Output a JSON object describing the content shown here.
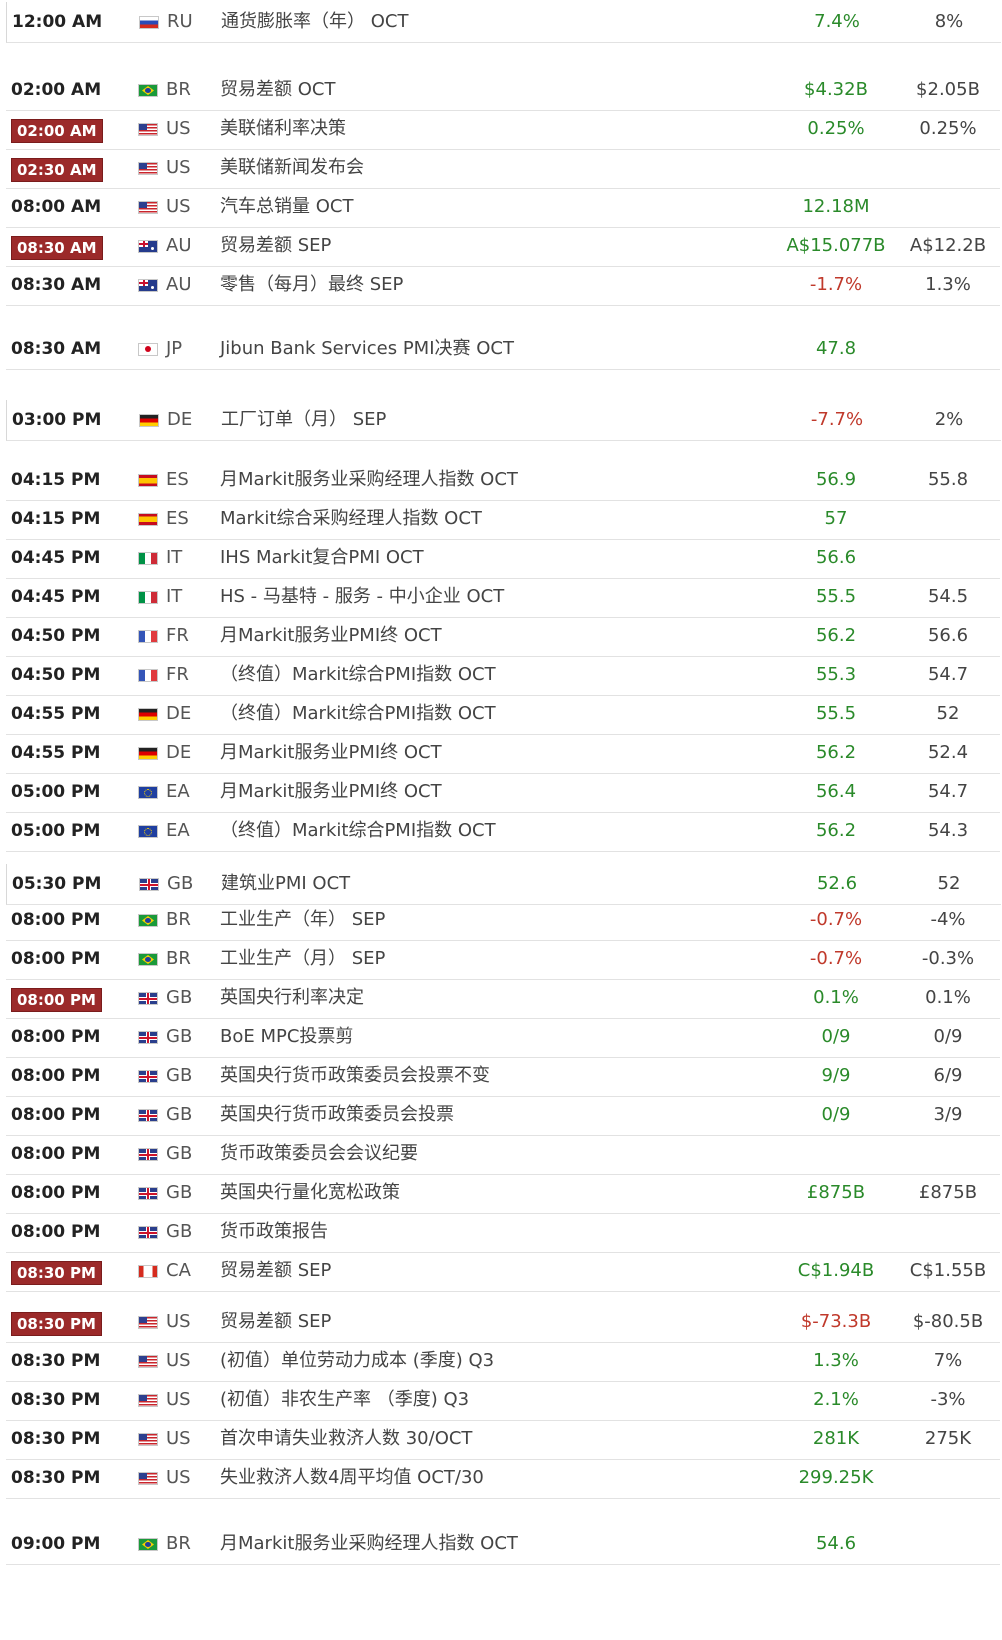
{
  "rows": [
    {
      "time": "12:00 AM",
      "highlight": false,
      "country": "RU",
      "flag": "ru-flag-icon",
      "event": "通货膨胀率（年） OCT",
      "actual": "7.4%",
      "actual_neg": false,
      "previous": "8%"
    },
    {
      "time": "02:00 AM",
      "highlight": false,
      "country": "BR",
      "flag": "br-flag-icon",
      "event": "贸易差额 OCT",
      "actual": "$4.32B",
      "actual_neg": false,
      "previous": "$2.05B"
    },
    {
      "time": "02:00 AM",
      "highlight": true,
      "country": "US",
      "flag": "us-flag-icon",
      "event": "美联储利率决策",
      "actual": "0.25%",
      "actual_neg": false,
      "previous": "0.25%"
    },
    {
      "time": "02:30 AM",
      "highlight": true,
      "country": "US",
      "flag": "us-flag-icon",
      "event": "美联储新闻发布会",
      "actual": "",
      "actual_neg": false,
      "previous": ""
    },
    {
      "time": "08:00 AM",
      "highlight": false,
      "country": "US",
      "flag": "us-flag-icon",
      "event": "汽车总销量 OCT",
      "actual": "12.18M",
      "actual_neg": false,
      "previous": ""
    },
    {
      "time": "08:30 AM",
      "highlight": true,
      "country": "AU",
      "flag": "au-flag-icon",
      "event": "贸易差额 SEP",
      "actual": "A$15.077B",
      "actual_neg": false,
      "previous": "A$12.2B"
    },
    {
      "time": "08:30 AM",
      "highlight": false,
      "country": "AU",
      "flag": "au-flag-icon",
      "event": "零售（每月）最终 SEP",
      "actual": "-1.7%",
      "actual_neg": true,
      "previous": "1.3%"
    },
    {
      "time": "08:30 AM",
      "highlight": false,
      "country": "JP",
      "flag": "jp-flag-icon",
      "event": "Jibun Bank Services PMI决赛 OCT",
      "actual": "47.8",
      "actual_neg": false,
      "previous": ""
    },
    {
      "time": "03:00 PM",
      "highlight": false,
      "country": "DE",
      "flag": "de-flag-icon",
      "event": "工厂订单（月） SEP",
      "actual": "-7.7%",
      "actual_neg": true,
      "previous": "2%"
    },
    {
      "time": "04:15 PM",
      "highlight": false,
      "country": "ES",
      "flag": "es-flag-icon",
      "event": "月Markit服务业采购经理人指数 OCT",
      "actual": "56.9",
      "actual_neg": false,
      "previous": "55.8"
    },
    {
      "time": "04:15 PM",
      "highlight": false,
      "country": "ES",
      "flag": "es-flag-icon",
      "event": "Markit综合采购经理人指数 OCT",
      "actual": "57",
      "actual_neg": false,
      "previous": ""
    },
    {
      "time": "04:45 PM",
      "highlight": false,
      "country": "IT",
      "flag": "it-flag-icon",
      "event": "IHS Markit复合PMI OCT",
      "actual": "56.6",
      "actual_neg": false,
      "previous": ""
    },
    {
      "time": "04:45 PM",
      "highlight": false,
      "country": "IT",
      "flag": "it-flag-icon",
      "event": "HS - 马基特 - 服务 - 中小企业 OCT",
      "actual": "55.5",
      "actual_neg": false,
      "previous": "54.5"
    },
    {
      "time": "04:50 PM",
      "highlight": false,
      "country": "FR",
      "flag": "fr-flag-icon",
      "event": "月Markit服务业PMI终 OCT",
      "actual": "56.2",
      "actual_neg": false,
      "previous": "56.6"
    },
    {
      "time": "04:50 PM",
      "highlight": false,
      "country": "FR",
      "flag": "fr-flag-icon",
      "event": "（终值）Markit综合PMI指数 OCT",
      "actual": "55.3",
      "actual_neg": false,
      "previous": "54.7"
    },
    {
      "time": "04:55 PM",
      "highlight": false,
      "country": "DE",
      "flag": "de-flag-icon",
      "event": "（终值）Markit综合PMI指数 OCT",
      "actual": "55.5",
      "actual_neg": false,
      "previous": "52"
    },
    {
      "time": "04:55 PM",
      "highlight": false,
      "country": "DE",
      "flag": "de-flag-icon",
      "event": "月Markit服务业PMI终 OCT",
      "actual": "56.2",
      "actual_neg": false,
      "previous": "52.4"
    },
    {
      "time": "05:00 PM",
      "highlight": false,
      "country": "EA",
      "flag": "ea-flag-icon",
      "event": "月Markit服务业PMI终 OCT",
      "actual": "56.4",
      "actual_neg": false,
      "previous": "54.7"
    },
    {
      "time": "05:00 PM",
      "highlight": false,
      "country": "EA",
      "flag": "ea-flag-icon",
      "event": "（终值）Markit综合PMI指数 OCT",
      "actual": "56.2",
      "actual_neg": false,
      "previous": "54.3"
    },
    {
      "time": "05:30 PM",
      "highlight": false,
      "country": "GB",
      "flag": "gb-flag-icon",
      "event": "建筑业PMI OCT",
      "actual": "52.6",
      "actual_neg": false,
      "previous": "52"
    },
    {
      "time": "08:00 PM",
      "highlight": false,
      "country": "BR",
      "flag": "br-flag-icon",
      "event": "工业生产（年） SEP",
      "actual": "-0.7%",
      "actual_neg": true,
      "previous": "-4%"
    },
    {
      "time": "08:00 PM",
      "highlight": false,
      "country": "BR",
      "flag": "br-flag-icon",
      "event": "工业生产（月） SEP",
      "actual": "-0.7%",
      "actual_neg": true,
      "previous": "-0.3%"
    },
    {
      "time": "08:00 PM",
      "highlight": true,
      "country": "GB",
      "flag": "gb-flag-icon",
      "event": "英国央行利率决定",
      "actual": "0.1%",
      "actual_neg": false,
      "previous": "0.1%"
    },
    {
      "time": "08:00 PM",
      "highlight": false,
      "country": "GB",
      "flag": "gb-flag-icon",
      "event": "BoE MPC投票剪",
      "actual": "0/9",
      "actual_neg": false,
      "previous": "0/9"
    },
    {
      "time": "08:00 PM",
      "highlight": false,
      "country": "GB",
      "flag": "gb-flag-icon",
      "event": "英国央行货币政策委员会投票不变",
      "actual": "9/9",
      "actual_neg": false,
      "previous": "6/9"
    },
    {
      "time": "08:00 PM",
      "highlight": false,
      "country": "GB",
      "flag": "gb-flag-icon",
      "event": "英国央行货币政策委员会投票",
      "actual": "0/9",
      "actual_neg": false,
      "previous": "3/9"
    },
    {
      "time": "08:00 PM",
      "highlight": false,
      "country": "GB",
      "flag": "gb-flag-icon",
      "event": "货币政策委员会会议纪要",
      "actual": "",
      "actual_neg": false,
      "previous": ""
    },
    {
      "time": "08:00 PM",
      "highlight": false,
      "country": "GB",
      "flag": "gb-flag-icon",
      "event": "英国央行量化宽松政策",
      "actual": "£875B",
      "actual_neg": false,
      "previous": "£875B"
    },
    {
      "time": "08:00 PM",
      "highlight": false,
      "country": "GB",
      "flag": "gb-flag-icon",
      "event": "货币政策报告",
      "actual": "",
      "actual_neg": false,
      "previous": ""
    },
    {
      "time": "08:30 PM",
      "highlight": true,
      "country": "CA",
      "flag": "ca-flag-icon",
      "event": "贸易差额 SEP",
      "actual": "C$1.94B",
      "actual_neg": false,
      "previous": "C$1.55B"
    },
    {
      "time": "08:30 PM",
      "highlight": true,
      "country": "US",
      "flag": "us-flag-icon",
      "event": "贸易差额 SEP",
      "actual": "$-73.3B",
      "actual_neg": true,
      "previous": "$-80.5B"
    },
    {
      "time": "08:30 PM",
      "highlight": false,
      "country": "US",
      "flag": "us-flag-icon",
      "event": "(初值）单位劳动力成本 (季度) Q3",
      "actual": "1.3%",
      "actual_neg": false,
      "previous": "7%"
    },
    {
      "time": "08:30 PM",
      "highlight": false,
      "country": "US",
      "flag": "us-flag-icon",
      "event": "(初值）非农生产率 （季度) Q3",
      "actual": "2.1%",
      "actual_neg": false,
      "previous": "-3%"
    },
    {
      "time": "08:30 PM",
      "highlight": false,
      "country": "US",
      "flag": "us-flag-icon",
      "event": "首次申请失业救济人数 30/OCT",
      "actual": "281K",
      "actual_neg": false,
      "previous": "275K"
    },
    {
      "time": "08:30 PM",
      "highlight": false,
      "country": "US",
      "flag": "us-flag-icon",
      "event": "失业救济人数4周平均值 OCT/30",
      "actual": "299.25K",
      "actual_neg": false,
      "previous": ""
    },
    {
      "time": "09:00 PM",
      "highlight": false,
      "country": "BR",
      "flag": "br-flag-icon",
      "event": "月Markit服务业采购经理人指数 OCT",
      "actual": "54.6",
      "actual_neg": false,
      "previous": ""
    }
  ],
  "colors": {
    "highlight_bg": "#9b2a2a",
    "positive": "#2a8a2a",
    "negative": "#c0392b",
    "divider": "#e2e2e2"
  }
}
